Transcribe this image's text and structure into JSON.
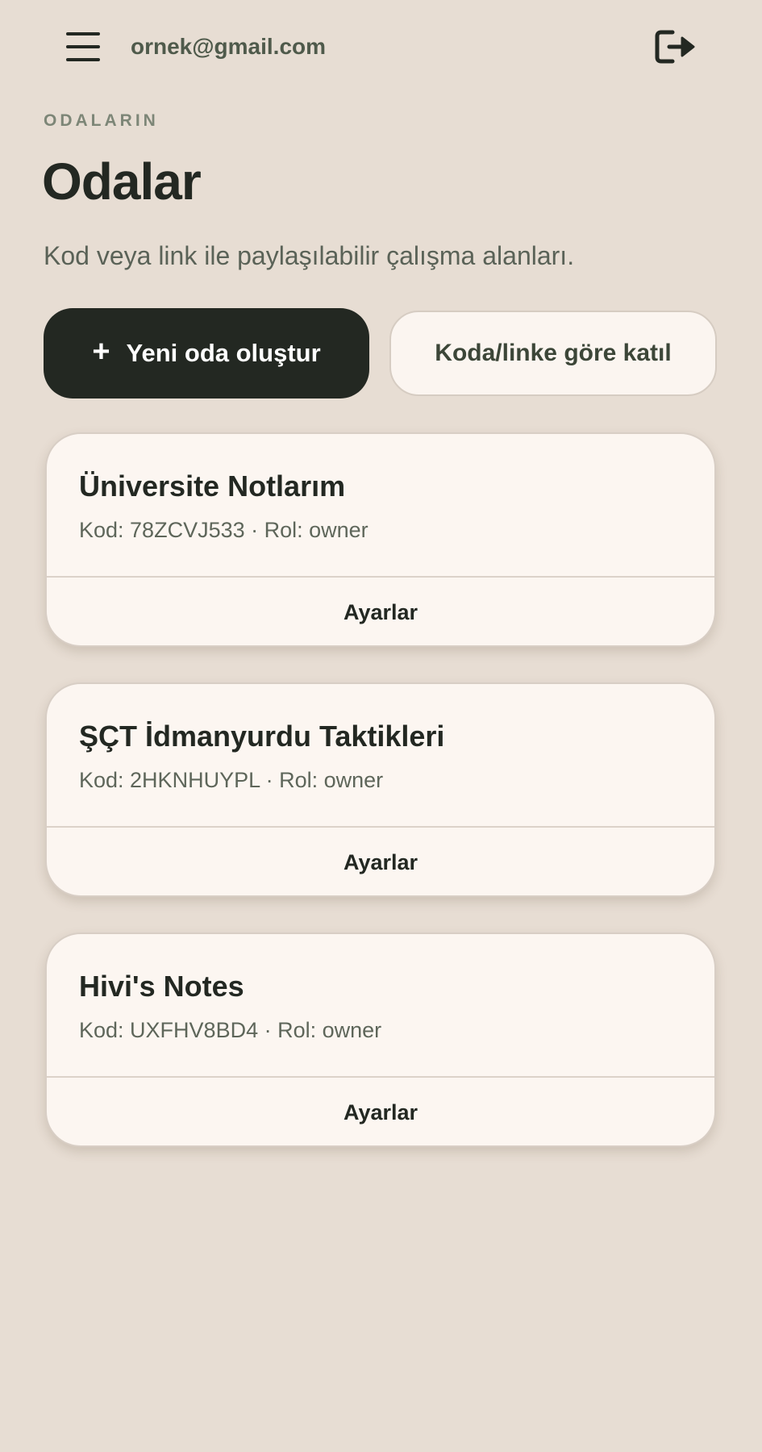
{
  "header": {
    "menu_icon": "hamburger-menu-icon",
    "user_email": "ornek@gmail.com",
    "logout_icon": "logout-icon"
  },
  "page": {
    "eyebrow": "ODALARIN",
    "title": "Odalar",
    "subtitle": "Kod veya link ile paylaşılabilir çalışma alanları."
  },
  "actions": {
    "create_icon": "+",
    "create_label": "Yeni oda oluştur",
    "join_label": "Koda/linke göre katıl"
  },
  "rooms": [
    {
      "name": "Üniversite Notlarım",
      "meta": "Kod: 78ZCVJ533 · Rol: owner",
      "action_label": "Ayarlar"
    },
    {
      "name": "ŞÇT İdmanyurdu Taktikleri",
      "meta": "Kod: 2HKNHUYPL · Rol: owner",
      "action_label": "Ayarlar"
    },
    {
      "name": "Hivi's Notes",
      "meta": "Kod: UXFHV8BD4 · Rol: owner",
      "action_label": "Ayarlar"
    }
  ],
  "colors": {
    "background": "#e7ddd3",
    "primary_button": "#232822",
    "card_background": "#fcf6f1",
    "text_dark": "#232822",
    "text_muted": "#5e665a"
  }
}
